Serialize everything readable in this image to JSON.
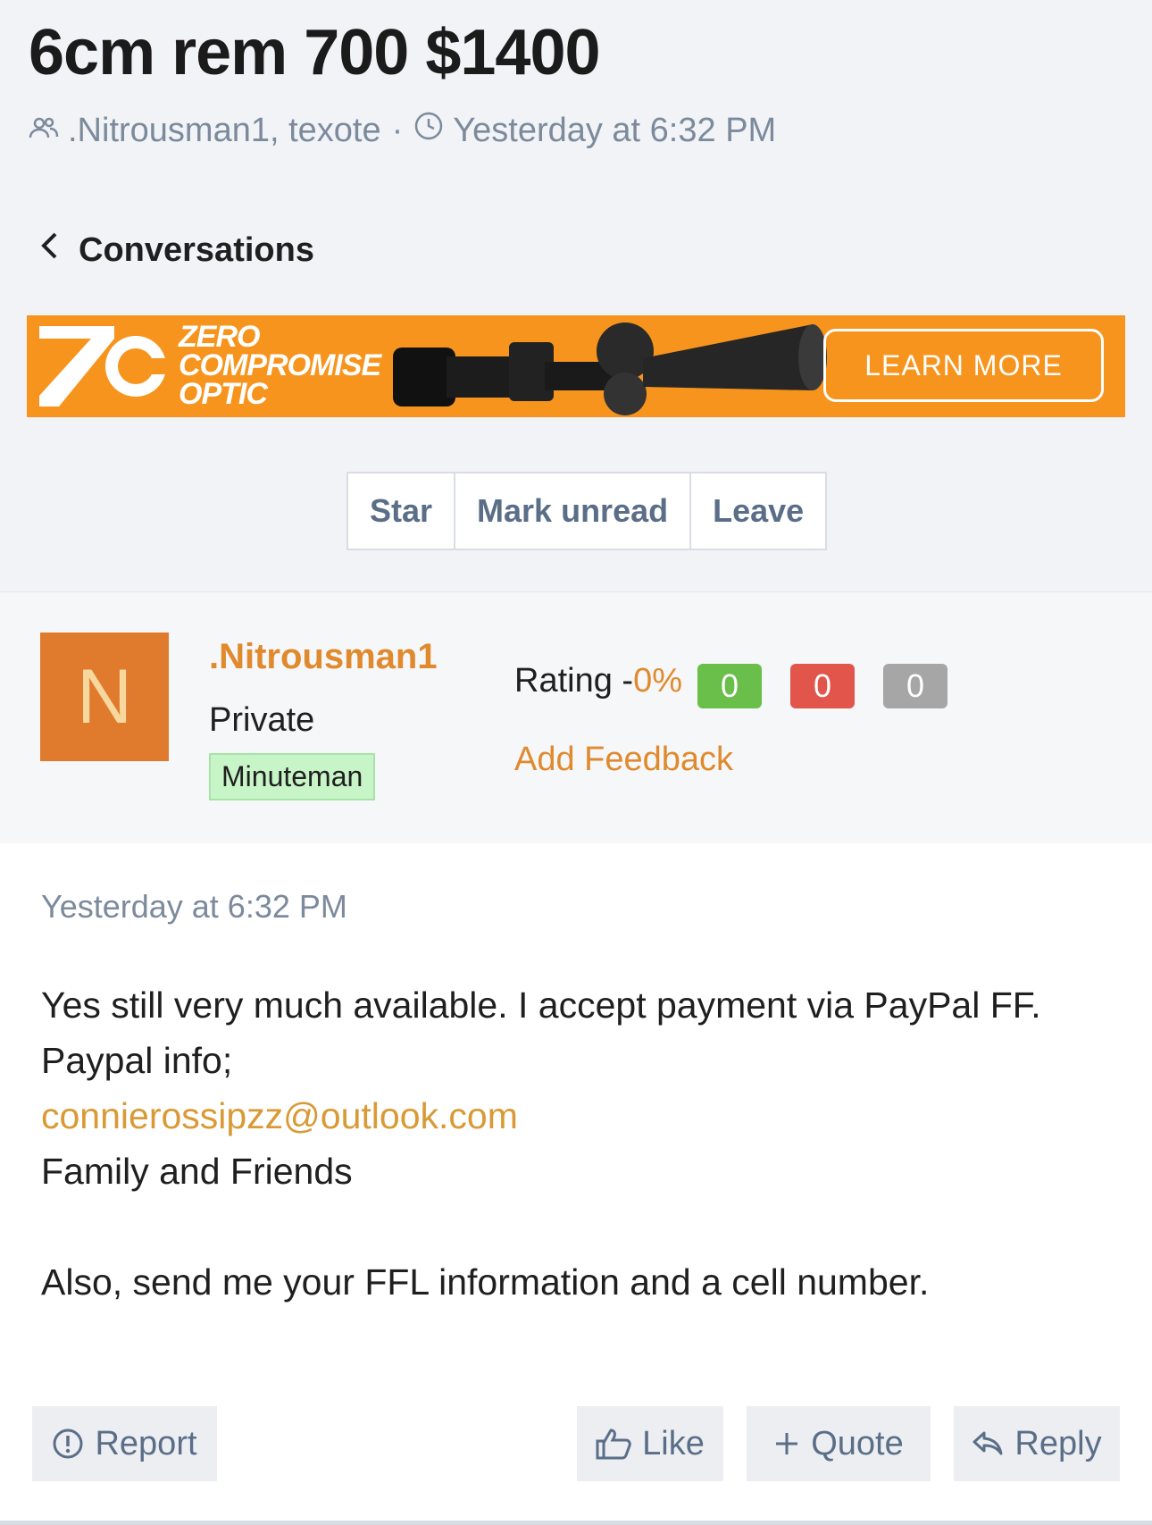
{
  "thread": {
    "title": "6cm rem 700 $1400",
    "participants": ".Nitrousman1, texote",
    "separator": "·",
    "time": "Yesterday at 6:32 PM"
  },
  "nav": {
    "back_label": "Conversations"
  },
  "ad": {
    "brand_line1": "ZERO",
    "brand_line2": "COMPROMISE",
    "brand_line3": "OPTIC",
    "cta_label": "LEARN MORE",
    "accent_color": "#f7941d"
  },
  "actions": {
    "star": "Star",
    "mark_unread": "Mark unread",
    "leave": "Leave"
  },
  "user": {
    "avatar_letter": "N",
    "name": ".Nitrousman1",
    "rank": "Private",
    "badge": "Minuteman",
    "rating_label": "Rating -",
    "rating_pct": "0%",
    "positive": "0",
    "negative": "0",
    "neutral": "0",
    "add_feedback": "Add Feedback"
  },
  "message": {
    "time": "Yesterday at 6:32 PM",
    "line1": "Yes still very much available. I accept payment via PayPal FF.",
    "line2": "Paypal info;",
    "email": "connierossipzz@outlook.com",
    "line3": "Family and Friends",
    "line4": "Also, send me your FFL information and a cell number."
  },
  "post_actions": {
    "report": "Report",
    "like": "Like",
    "quote": "Quote",
    "reply": "Reply"
  }
}
